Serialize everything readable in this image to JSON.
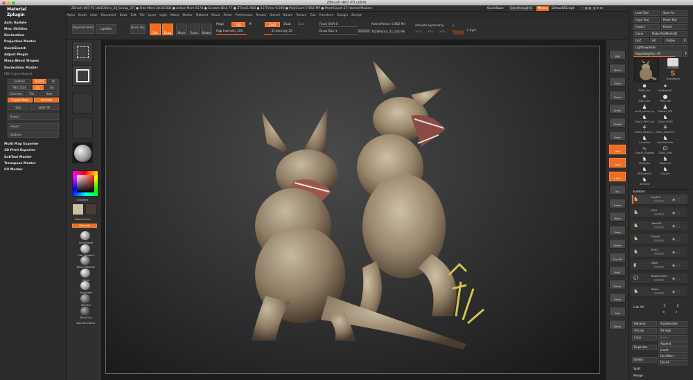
{
  "window": {
    "title": "ZBrush 4R7 P3 (x64)",
    "doc_info": "ZBrush 4R7 P3 [ab1050rv_34_Group_37]   ● Free Mem 28.423GB ● Active Mem 6178 ● Scratch Disk 77 ● ZTime1.983 ● 13 Timer 0.006 ● PolyCount 7.892 MP ● MeshCount 27   Hamed Moaimi",
    "quicksave": "QuickSave",
    "see_through": "See-through 0",
    "menus_btn": "Menus",
    "default_zscript": "DefaultZScript"
  },
  "menubar": [
    "Alpha",
    "Brush",
    "Color",
    "Document",
    "Draw",
    "Edit",
    "File",
    "Layer",
    "Light",
    "Macro",
    "Marker",
    "Material",
    "Movie",
    "Picker",
    "Preferences",
    "Render",
    "Stencil",
    "Stroke",
    "Texture",
    "Tool",
    "Transform",
    "Zplugin",
    "Zscript"
  ],
  "left_panel": {
    "material_head": "Material",
    "zplugin_head": "Zplugin",
    "items": [
      "Auto Update",
      "Misc Utilities",
      "Decimation",
      "Projection Master",
      "QuickSketch",
      "Adjust Plugin",
      "Maya Blend Shapes",
      "Decimation Master",
      "FBX ExportImport"
    ],
    "fbx": {
      "subtool": "Subtool",
      "visible": "Visible",
      "all": "All",
      "fbx_ver": "FBX 2014",
      "ascii": "asc",
      "binary": "bin",
      "cameras": "Cameras",
      "tris": "Tris",
      "smooth": "Smt",
      "export_maps": "Export Maps",
      "maps": "Maps",
      "normal_map": "Normals",
      "tga": "TGA",
      "res": "4096 TIF",
      "export": "Export",
      "import": "Import",
      "options": "Options"
    },
    "more_items": [
      "Multi Map Exporter",
      "3D Print Exporter",
      "SubTool Master",
      "Transpose Master",
      "UV Master"
    ]
  },
  "top_shelf": {
    "projection_master": "Projection Master",
    "lightbox": "LightBox",
    "quick_sketch": "Quick Sketch",
    "edit": "Edit",
    "draw": "Draw",
    "move": "Move",
    "scale": "Scale",
    "rotate": "Rotate",
    "mrgb": "Mrgb",
    "rgb": "Rgb",
    "m": "M",
    "zadd": "Zadd",
    "zsub": "Zsub",
    "zcut": "Zcut",
    "focal_shift": "Focal Shift 0",
    "draw_size": "Draw Size 1",
    "dynamic": "Dynamic",
    "active_points": "ActivePoints: 5.862 Mil",
    "total_points": "TotalPoints: 21.235 Mil",
    "activate_symmetry": "Activate Symmetry",
    "rgb_intensity": "Rgb Intensity 100",
    "z_intensity": "Z Intensity 25",
    "x": ">X<",
    "y": ">Y<",
    "z": ">Z<",
    "r": "(R)",
    "l_sym": "L.Sym",
    "axis_lbl": "M"
  },
  "tool_column": {
    "gradient": "Gradient",
    "switch_color": "SwitchColor",
    "alternate": "Alternate",
    "materials": [
      "SkinShade",
      "Cab_Diaglo3",
      "Basic Material",
      "Metal",
      "Toyplastic",
      "Wrinkle",
      "BlinnGrp",
      "BackfaceMask"
    ]
  },
  "right_strip": [
    "BPR",
    "SPix 3",
    "Scroll",
    "Zoom",
    "Actual",
    "AAHalf",
    "Persp",
    "Floor",
    "Local",
    "L.Sym",
    "Xyz",
    "Frame",
    "Move",
    "Scale",
    "Rotate",
    "Line Fill",
    "PolyF",
    "Transp",
    "Ghost",
    "Solo",
    "Xpose"
  ],
  "right_panel": {
    "load_tool": "Load Tool",
    "save_as": "Save As",
    "copy_tool": "Copy Tool",
    "paste_tool": "Paste Tool",
    "import": "Import",
    "export": "Export",
    "clone": "Clone",
    "make_polymesh": "Make PolyMesh3D",
    "goz": "GoZ",
    "all": "All",
    "visible": "Visible",
    "r": "R",
    "lightbox_tools": "Lightbox▸Tools",
    "current_tool": "KaganDog/Fut. 49",
    "thumbs": [
      "Cylinder3D",
      "SimpleBrush",
      "PM3D_Star",
      "PolyMesh3D",
      "ZSkt1_Star",
      "PM3D_Sph",
      "pm3d_variant_copy",
      "ZSketch_ZPS",
      "ZTool1_7900_Cube",
      "ZTool1_PM3D",
      "ZTool1_ZSketch_ha",
      "ZTool1_ZSketch_m",
      "CurveTube",
      "HairTubeDollar",
      "ZTool15_ShapeR4",
      "ZTool1_Shell",
      "PM3D_Bal",
      "ZTool1_fan",
      "PM3DeHeleX",
      "Dog_Dm",
      "Gizmo3D"
    ],
    "subtool_head": "Subtool",
    "subtool_names": [
      "Layer1",
      "Fold",
      "Tooth31",
      "Flesh2",
      "Eye1",
      "Nose",
      "Buttonhole1",
      "Spine"
    ],
    "list_all": "List All",
    "rename": "Rename",
    "auto_reorder": "AutoReorder",
    "all_low": "All Low",
    "all_high": "All High",
    "copy": "Copy",
    "paste": "Paste",
    "append": "Append",
    "duplicate": "Duplicate",
    "insert": "Insert",
    "del_other": "Del Other",
    "delete": "Delete",
    "del_all": "Del All",
    "split": "Split",
    "merge": "Merge"
  }
}
